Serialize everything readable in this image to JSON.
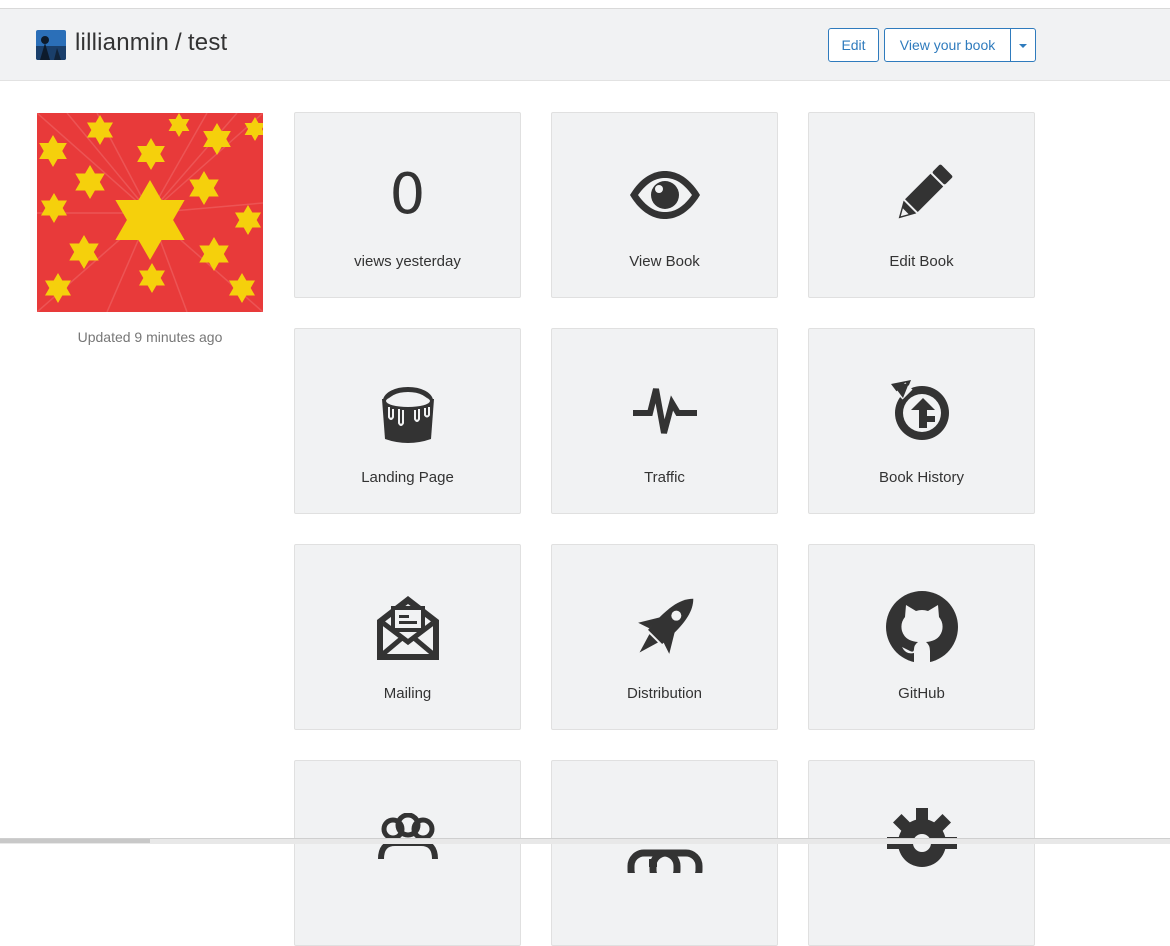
{
  "header": {
    "owner": "lillianmin",
    "separator": "/",
    "book": "test",
    "edit_label": "Edit",
    "view_label": "View your book"
  },
  "cover": {
    "updated": "Updated 9 minutes ago",
    "colors": {
      "background": "#e83a3a",
      "stars": "#f5d00c"
    }
  },
  "tiles": [
    {
      "value": "0",
      "label": "views yesterday",
      "icon": "counter"
    },
    {
      "label": "View Book",
      "icon": "eye-icon"
    },
    {
      "label": "Edit Book",
      "icon": "pencil-icon"
    },
    {
      "label": "Landing Page",
      "icon": "paint-bucket-icon"
    },
    {
      "label": "Traffic",
      "icon": "pulse-icon"
    },
    {
      "label": "Book History",
      "icon": "history-icon"
    },
    {
      "label": "Mailing",
      "icon": "envelope-icon"
    },
    {
      "label": "Distribution",
      "icon": "rocket-icon"
    },
    {
      "label": "GitHub",
      "icon": "github-icon"
    },
    {
      "label": "",
      "icon": "people-icon"
    },
    {
      "label": "",
      "icon": "money-icon"
    },
    {
      "label": "",
      "icon": "gear-icon"
    }
  ],
  "colors": {
    "accent": "#2f7bbd",
    "tile_bg": "#f1f2f3",
    "icon": "#333333"
  }
}
